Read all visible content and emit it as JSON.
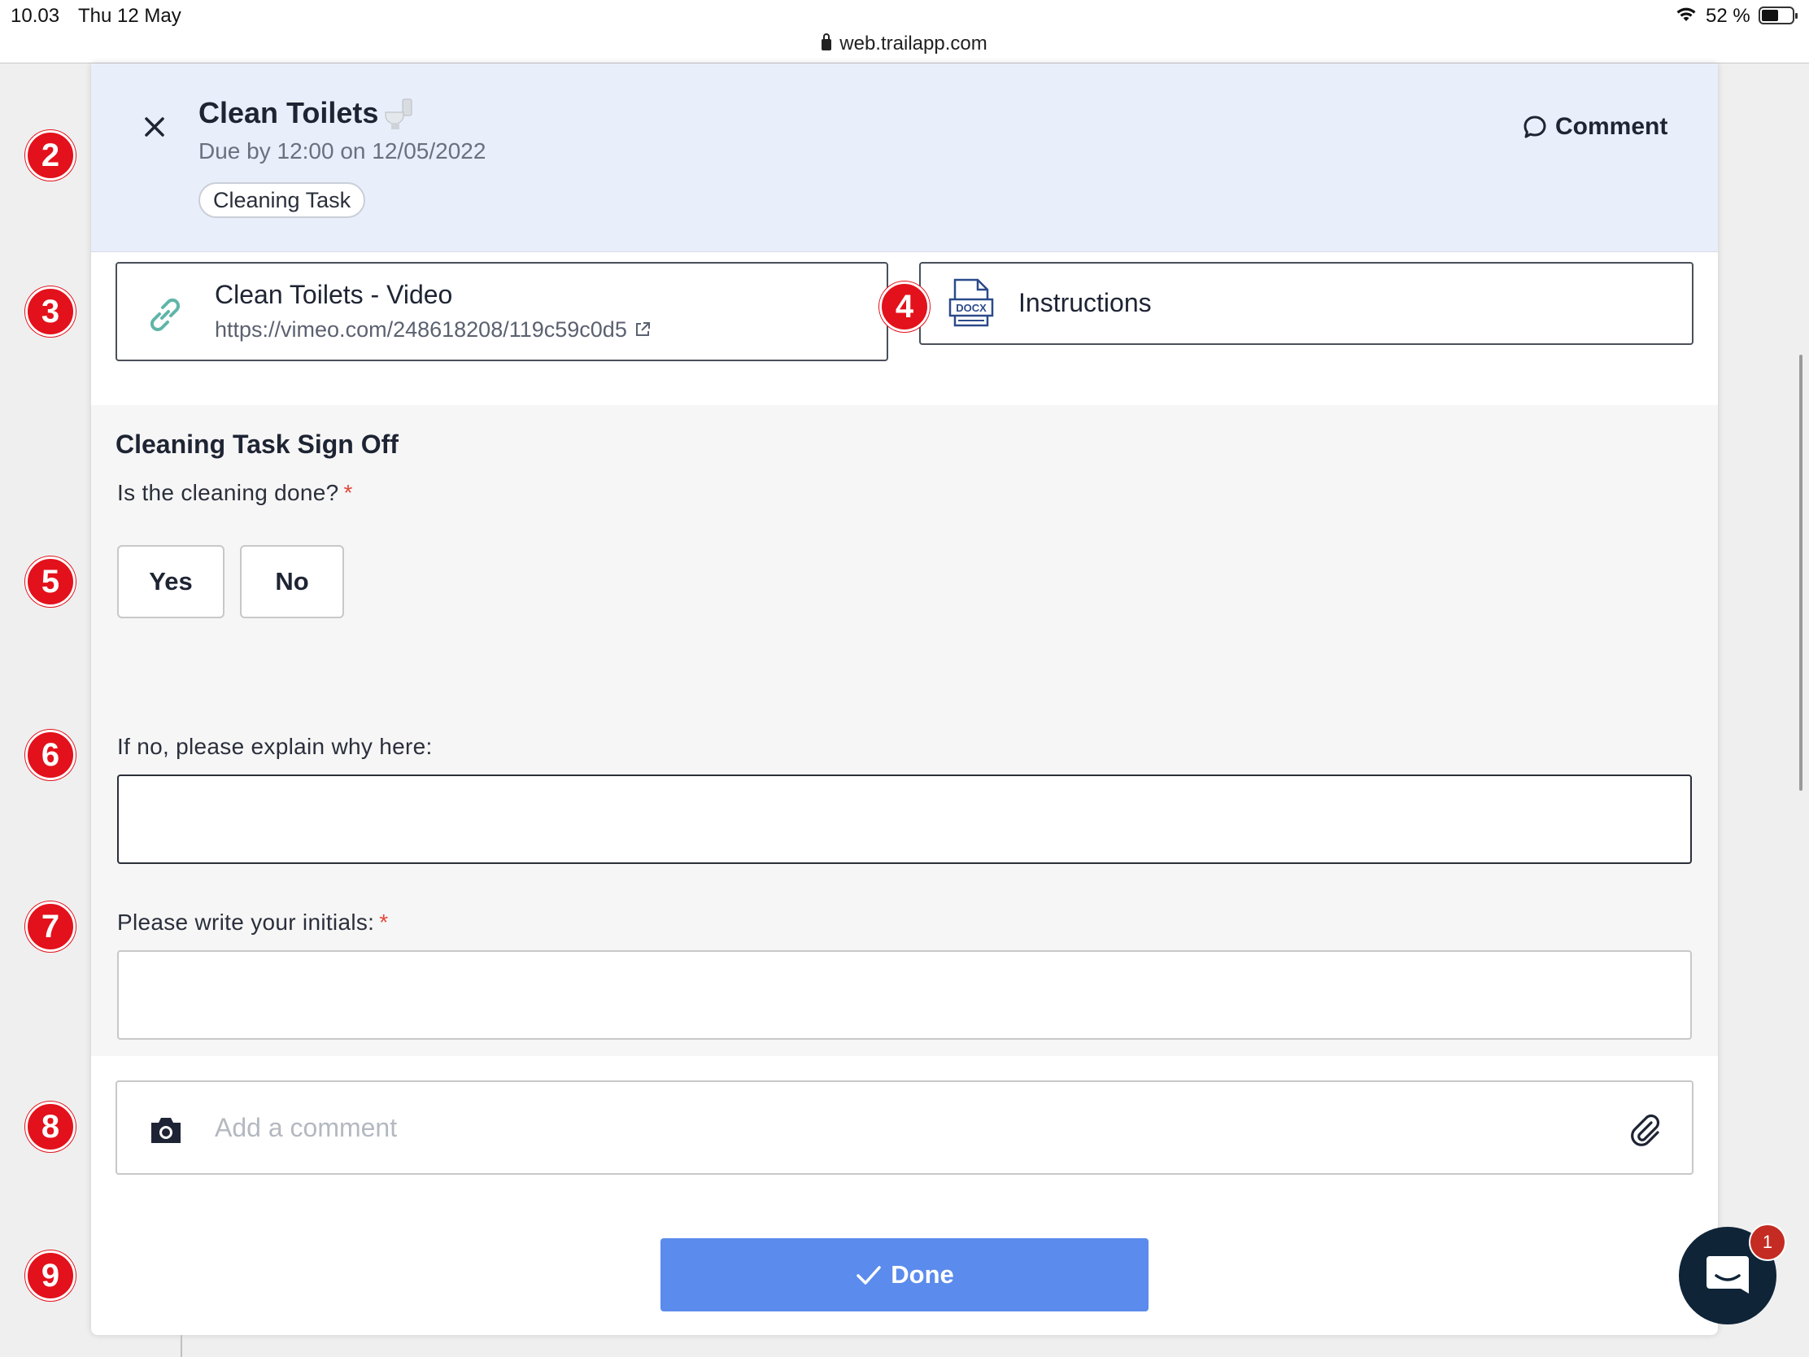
{
  "status_bar": {
    "time": "10.03",
    "date": "Thu 12 May",
    "url": "web.trailapp.com",
    "battery": "52 %"
  },
  "badges": [
    "2",
    "3",
    "4",
    "5",
    "6",
    "7",
    "8",
    "9"
  ],
  "task": {
    "title": "Clean Toilets",
    "title_icon": "toilet-icon",
    "due": "Due by 12:00 on 12/05/2022",
    "tag": "Cleaning Task",
    "comment_label": "Comment"
  },
  "attachments": {
    "video": {
      "title": "Clean Toilets - Video",
      "url": "https://vimeo.com/248618208/119c59c0d5",
      "icon": "link-icon"
    },
    "doc": {
      "title": "Instructions",
      "file_type": "DOCX",
      "icon": "docx-file-icon"
    }
  },
  "form": {
    "section_title": "Cleaning Task Sign Off",
    "q1": {
      "label": "Is the cleaning done?",
      "required_mark": "*",
      "options": [
        "Yes",
        "No"
      ]
    },
    "q2": {
      "label": "If no, please explain why here:",
      "value": ""
    },
    "q3": {
      "label": "Please write your initials:",
      "required_mark": "*",
      "value": ""
    }
  },
  "comment_bar": {
    "placeholder": "Add a comment",
    "value": ""
  },
  "done_label": "Done",
  "chat": {
    "unread_count": "1"
  },
  "colors": {
    "header_bg": "#e8effa",
    "primary": "#5b8bec",
    "badge_red": "#e3111b",
    "required": "#e4473a",
    "chat_bg": "#0f2437"
  }
}
